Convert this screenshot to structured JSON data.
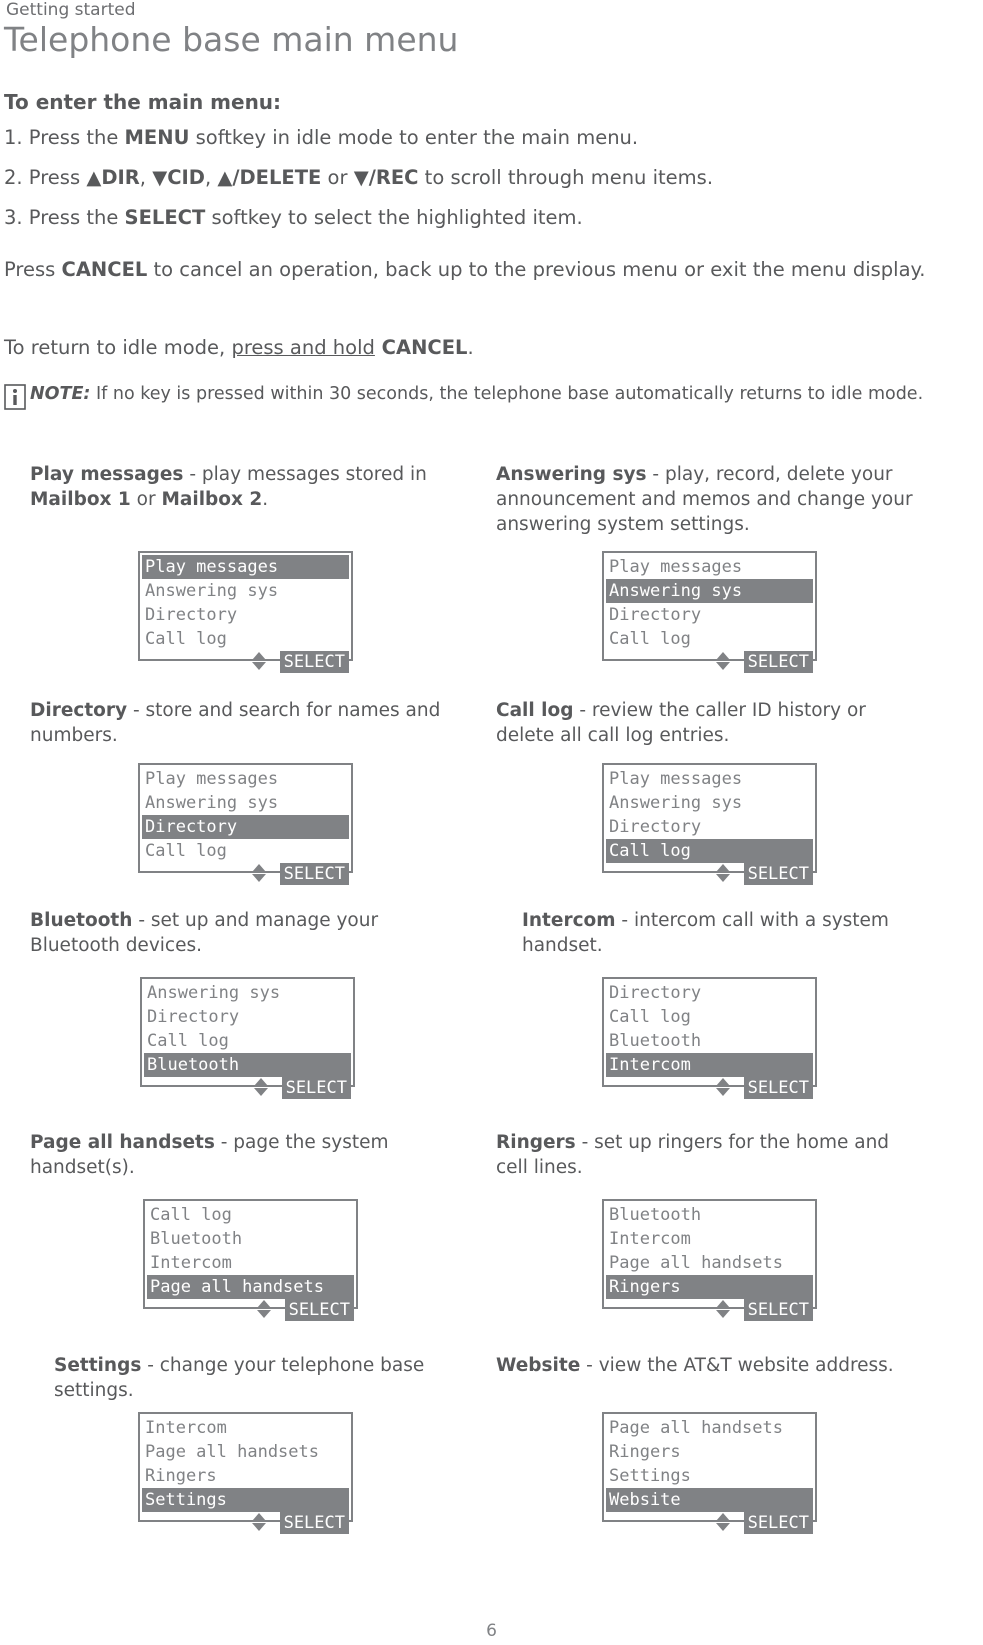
{
  "header": {
    "running_head": "Getting started",
    "title": "Telephone base main menu"
  },
  "intro": {
    "heading": "To enter the main menu:",
    "step1_pre": "1. Press the ",
    "step1_bold": "MENU",
    "step1_post": " softkey in idle mode to enter the main menu.",
    "step2_pre": "2. Press ",
    "step2_b1": "▲DIR",
    "step2_sep1": ", ",
    "step2_b2": "▼CID",
    "step2_sep2": ", ",
    "step2_b3": "▲/DELETE",
    "step2_or": " or ",
    "step2_b4": "▼/REC",
    "step2_post": " to scroll through menu items.",
    "step3_pre": "3. Press the ",
    "step3_bold": "SELECT",
    "step3_post": " softkey to select the highlighted item.",
    "para1_pre": "Press ",
    "para1_bold": "CANCEL",
    "para1_post": " to cancel an operation, back up to the previous menu or exit the menu display.",
    "para2_pre": "To return to idle mode, ",
    "para2_underline": "press and hold",
    "para2_bold": " CANCEL",
    "para2_post": "."
  },
  "note": {
    "label": "NOTE:",
    "text": " If no key is pressed within 30 seconds, the telephone base automatically returns to idle mode."
  },
  "items": [
    {
      "desc_bold": "Play messages",
      "desc_mid": " - play messages stored in ",
      "desc_bold2": "Mailbox 1",
      "desc_mid2": " or ",
      "desc_bold3": "Mailbox 2",
      "desc_end": ".",
      "lcd": {
        "lines": [
          "Play messages",
          "Answering sys",
          "Directory",
          "Call log"
        ],
        "highlight": 0,
        "softkey": "SELECT"
      }
    },
    {
      "desc_bold": "Answering sys",
      "desc_end": " - play, record, delete your announcement and memos and change your answering system settings.",
      "lcd": {
        "lines": [
          "Play messages",
          "Answering sys",
          "Directory",
          "Call log"
        ],
        "highlight": 1,
        "softkey": "SELECT"
      }
    },
    {
      "desc_bold": "Directory",
      "desc_end": " - store and search for names and numbers.",
      "lcd": {
        "lines": [
          "Play messages",
          "Answering sys",
          "Directory",
          "Call log"
        ],
        "highlight": 2,
        "softkey": "SELECT"
      }
    },
    {
      "desc_bold": "Call log",
      "desc_end": " - review the caller ID history or delete all call log entries.",
      "lcd": {
        "lines": [
          "Play messages",
          "Answering sys",
          "Directory",
          "Call log"
        ],
        "highlight": 3,
        "softkey": "SELECT"
      }
    },
    {
      "desc_bold": "Bluetooth",
      "desc_end": " - set up and manage your Bluetooth devices.",
      "lcd": {
        "lines": [
          "Answering sys",
          "Directory",
          "Call log",
          "Bluetooth"
        ],
        "highlight": 3,
        "softkey": "SELECT"
      }
    },
    {
      "desc_bold": "Intercom",
      "desc_end": " - intercom call with a system handset.",
      "lcd": {
        "lines": [
          "Directory",
          "Call log",
          "Bluetooth",
          "Intercom"
        ],
        "highlight": 3,
        "softkey": "SELECT"
      }
    },
    {
      "desc_bold": "Page all handsets",
      "desc_end": " - page the system handset(s).",
      "lcd": {
        "lines": [
          "Call log",
          "Bluetooth",
          "Intercom",
          "Page all handsets"
        ],
        "highlight": 3,
        "softkey": "SELECT"
      }
    },
    {
      "desc_bold": "Ringers",
      "desc_end": " - set up ringers for the home and cell lines.",
      "lcd": {
        "lines": [
          "Bluetooth",
          "Intercom",
          "Page all handsets",
          "Ringers"
        ],
        "highlight": 3,
        "softkey": "SELECT"
      }
    },
    {
      "desc_bold": "Settings",
      "desc_end": " - change your telephone base settings.",
      "lcd": {
        "lines": [
          "Intercom",
          "Page all handsets",
          "Ringers",
          "Settings"
        ],
        "highlight": 3,
        "softkey": "SELECT"
      }
    },
    {
      "desc_bold": "Website",
      "desc_end": " - view the AT&T website address.",
      "lcd": {
        "lines": [
          "Page all handsets",
          "Ringers",
          "Settings",
          "Website"
        ],
        "highlight": 3,
        "softkey": "SELECT"
      }
    }
  ],
  "footer": {
    "page_number": "6"
  }
}
